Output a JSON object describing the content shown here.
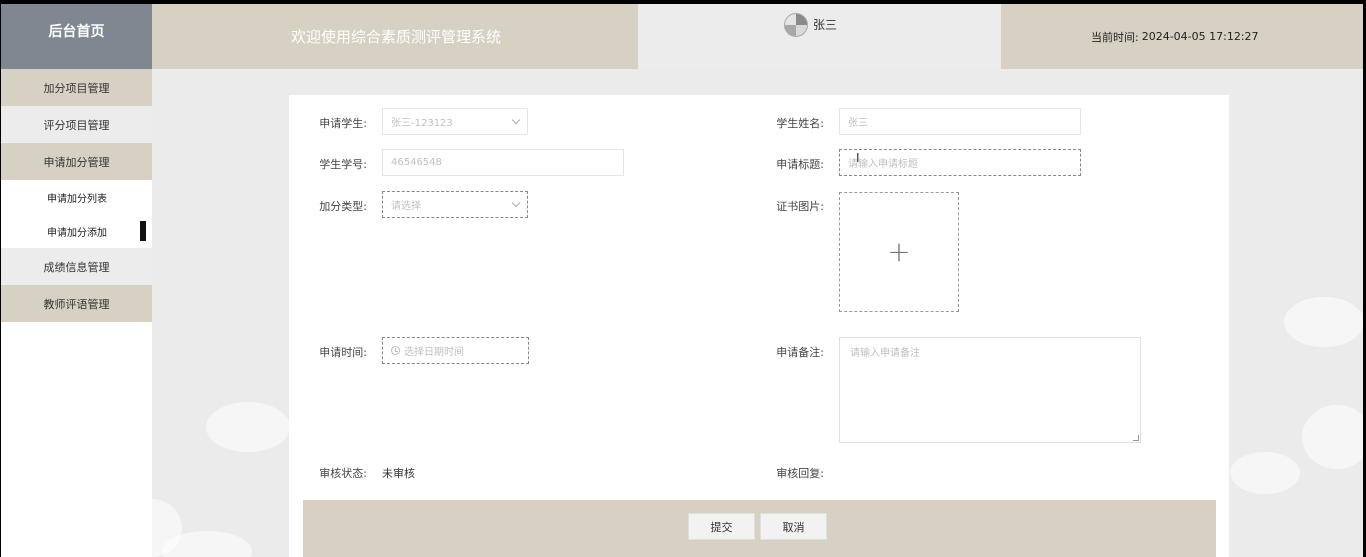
{
  "header": {
    "brand": "后台首页",
    "welcome": "欢迎使用综合素质测评管理系统",
    "username": "张三",
    "time_label": "当前时间:",
    "time_value": "2024-04-05 17:12:27"
  },
  "sidebar": {
    "items": [
      {
        "label": "加分项目管理"
      },
      {
        "label": "评分项目管理"
      },
      {
        "label": "申请加分管理"
      },
      {
        "label": "申请加分列表"
      },
      {
        "label": "申请加分添加"
      },
      {
        "label": "成绩信息管理"
      },
      {
        "label": "教师评语管理"
      }
    ]
  },
  "form": {
    "student_label": "申请学生:",
    "student_value": "张三-123123",
    "name_label": "学生姓名:",
    "name_value": "张三",
    "number_label": "学生学号:",
    "number_value": "46546548",
    "title_label": "申请标题:",
    "title_placeholder": "请输入申请标题",
    "type_label": "加分类型:",
    "type_placeholder": "请选择",
    "cert_label": "证书图片:",
    "time_label": "申请时间:",
    "time_placeholder": "选择日期时间",
    "remark_label": "申请备注:",
    "remark_placeholder": "请输入申请备注",
    "status_label": "审核状态:",
    "status_value": "未审核",
    "reply_label": "审核回复:"
  },
  "actions": {
    "submit": "提交",
    "cancel": "取消"
  }
}
